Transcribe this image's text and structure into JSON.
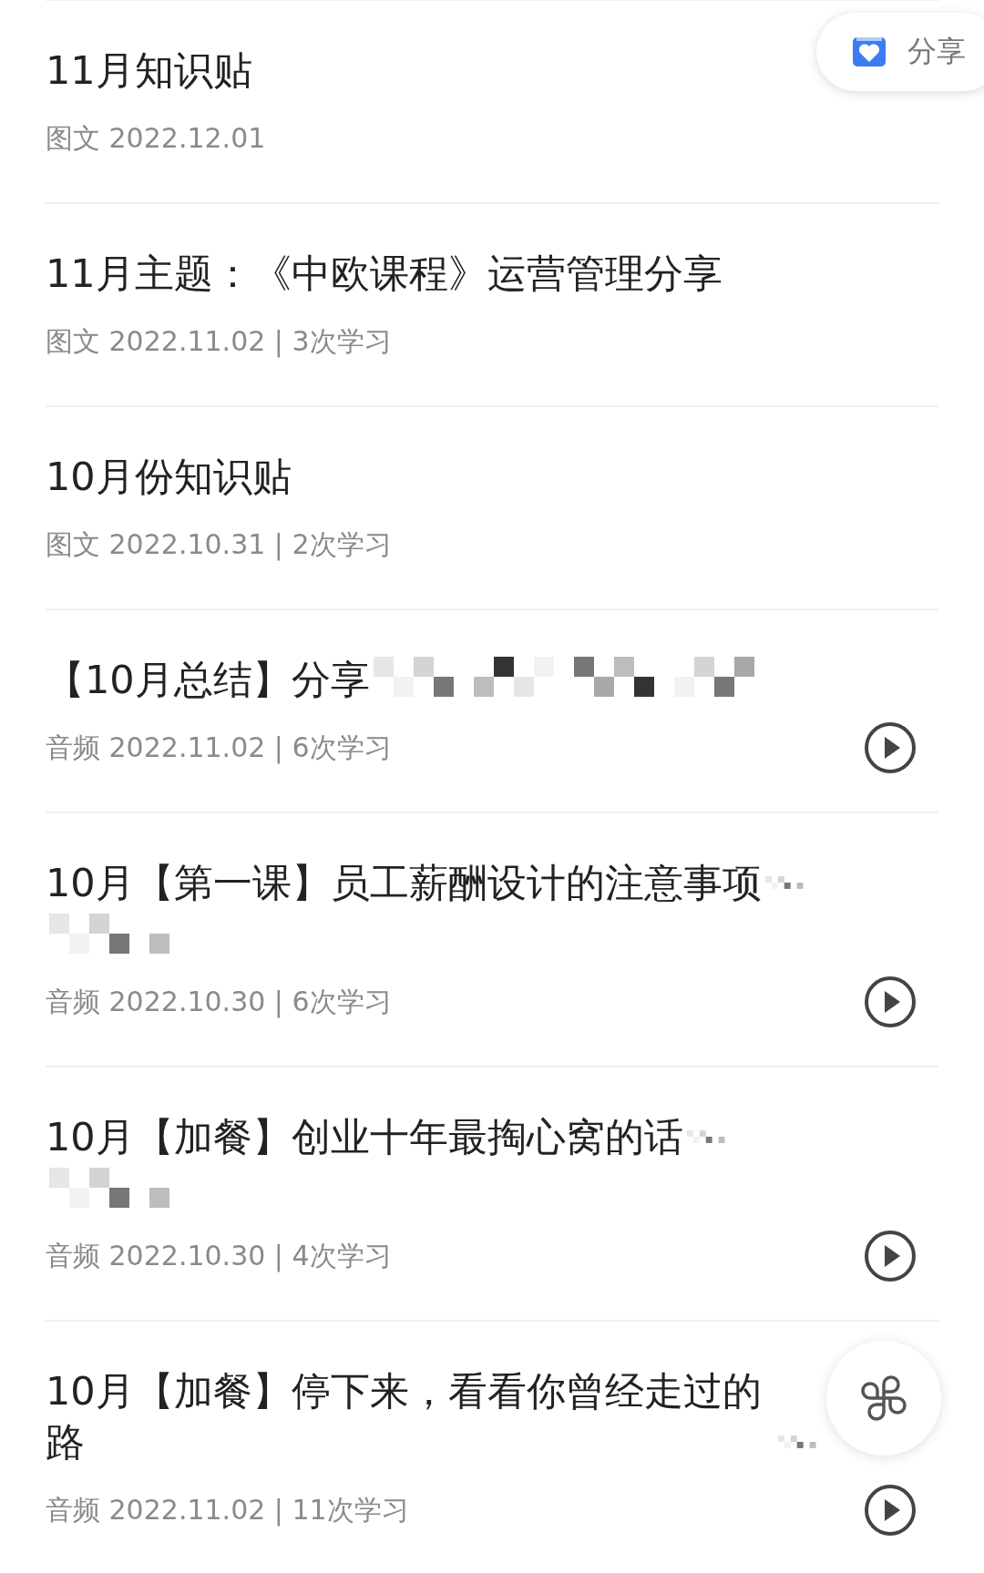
{
  "share_button": {
    "label": "分享"
  },
  "items": [
    {
      "kind": "article",
      "title": "11月知识贴",
      "meta": "图文 2022.12.01"
    },
    {
      "kind": "article",
      "title": "11月主题：《中欧课程》运营管理分享",
      "meta": "图文 2022.11.02 | 3次学习"
    },
    {
      "kind": "article",
      "title": "10月份知识贴",
      "meta": "图文 2022.10.31 | 2次学习"
    },
    {
      "kind": "audio",
      "title": "【10月总结】分享",
      "redacted_wide": true,
      "meta": "音频 2022.11.02 | 6次学习"
    },
    {
      "kind": "audio",
      "title": "10月【第一课】员工薪酬设计的注意事项",
      "redacted_end": true,
      "redacted_next_line": true,
      "meta": "音频 2022.10.30 | 6次学习"
    },
    {
      "kind": "audio",
      "title": "10月【加餐】创业十年最掏心窝的话",
      "redacted_end": true,
      "redacted_next_line": true,
      "meta": "音频 2022.10.30 | 4次学习"
    },
    {
      "kind": "audio",
      "title": "10月【加餐】停下来，看看你曾经走过的路",
      "redacted_end": true,
      "meta": "音频 2022.11.02 | 11次学习"
    }
  ],
  "floating_button": {
    "kind": "menu"
  }
}
